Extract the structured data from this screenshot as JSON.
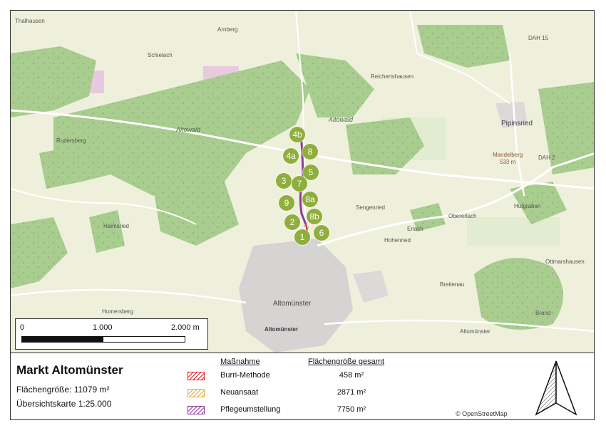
{
  "map": {
    "places": [
      {
        "id": "thalhausen",
        "name": "Thalhausen",
        "kind": "plain"
      },
      {
        "id": "arnberg",
        "name": "Arnberg",
        "kind": "plain"
      },
      {
        "id": "schielach",
        "name": "Schielach",
        "kind": "plain"
      },
      {
        "id": "reichertshausen",
        "name": "Reichertshausen",
        "kind": "plain"
      },
      {
        "id": "dah15",
        "name": "DAH 15",
        "kind": "plain"
      },
      {
        "id": "altowald1",
        "name": "Altowald",
        "kind": "italic"
      },
      {
        "id": "altowald2",
        "name": "Altowald",
        "kind": "italic"
      },
      {
        "id": "rudersberg",
        "name": "Rudersberg",
        "kind": "plain"
      },
      {
        "id": "pipinsried",
        "name": "Pipinsried",
        "kind": "plain"
      },
      {
        "id": "mandelberg",
        "name": "Mandelberg",
        "kind": "plain"
      },
      {
        "id": "mandelberg_h",
        "name": "533 m",
        "kind": "plain"
      },
      {
        "id": "dah2",
        "name": "DAH 2",
        "kind": "plain"
      },
      {
        "id": "sengenried",
        "name": "Sengenried",
        "kind": "plain"
      },
      {
        "id": "hutgraben",
        "name": "Hutgraben",
        "kind": "plain"
      },
      {
        "id": "oberer_lach",
        "name": "Obererlach",
        "kind": "plain"
      },
      {
        "id": "haimsried",
        "name": "Haimsried",
        "kind": "plain"
      },
      {
        "id": "erlach",
        "name": "Erlach",
        "kind": "plain"
      },
      {
        "id": "hohenried",
        "name": "Hohenried",
        "kind": "plain"
      },
      {
        "id": "ottmarshausen",
        "name": "Ottmarshausen",
        "kind": "plain"
      },
      {
        "id": "breitenau",
        "name": "Breitenau",
        "kind": "plain"
      },
      {
        "id": "humersberg",
        "name": "Humersberg",
        "kind": "plain"
      },
      {
        "id": "altomuenster",
        "name": "Altomünster",
        "kind": "town"
      },
      {
        "id": "altomuenster_tag",
        "name": "Altomünster",
        "kind": "towntag"
      },
      {
        "id": "altomuenster2",
        "name": "Altomünster",
        "kind": "plain"
      },
      {
        "id": "brand",
        "name": "Brand",
        "kind": "plain"
      }
    ],
    "markers": [
      "4b",
      "8",
      "4a",
      "5",
      "3",
      "7",
      "8a",
      "9",
      "8b",
      "2",
      "6",
      "1"
    ]
  },
  "scale": {
    "labels": [
      "0",
      "1.000",
      "2.000 m"
    ]
  },
  "legend": {
    "title": "Markt Altomünster",
    "area": "Flächengröße: 11079 m²",
    "map_scale": "Übersichtskarte 1:25.000",
    "col_measure": "Maßnahme",
    "col_area": "Flächengröße gesamt",
    "items": [
      {
        "name": "Burri-Methode",
        "value": "458 m²",
        "color": "#d62728"
      },
      {
        "name": "Neuansaat",
        "value": "2871 m²",
        "color": "#f0a830"
      },
      {
        "name": "Pflegeumstellung",
        "value": "7750 m²",
        "color": "#8e3c9a"
      }
    ],
    "credit": "© OpenStreetMap"
  },
  "colors": {
    "forest": "#a9cc8f",
    "meadow": "#eef0dc",
    "marker": "#8fae3c",
    "route": "#8e3c9a",
    "route_end": "#d62728"
  }
}
